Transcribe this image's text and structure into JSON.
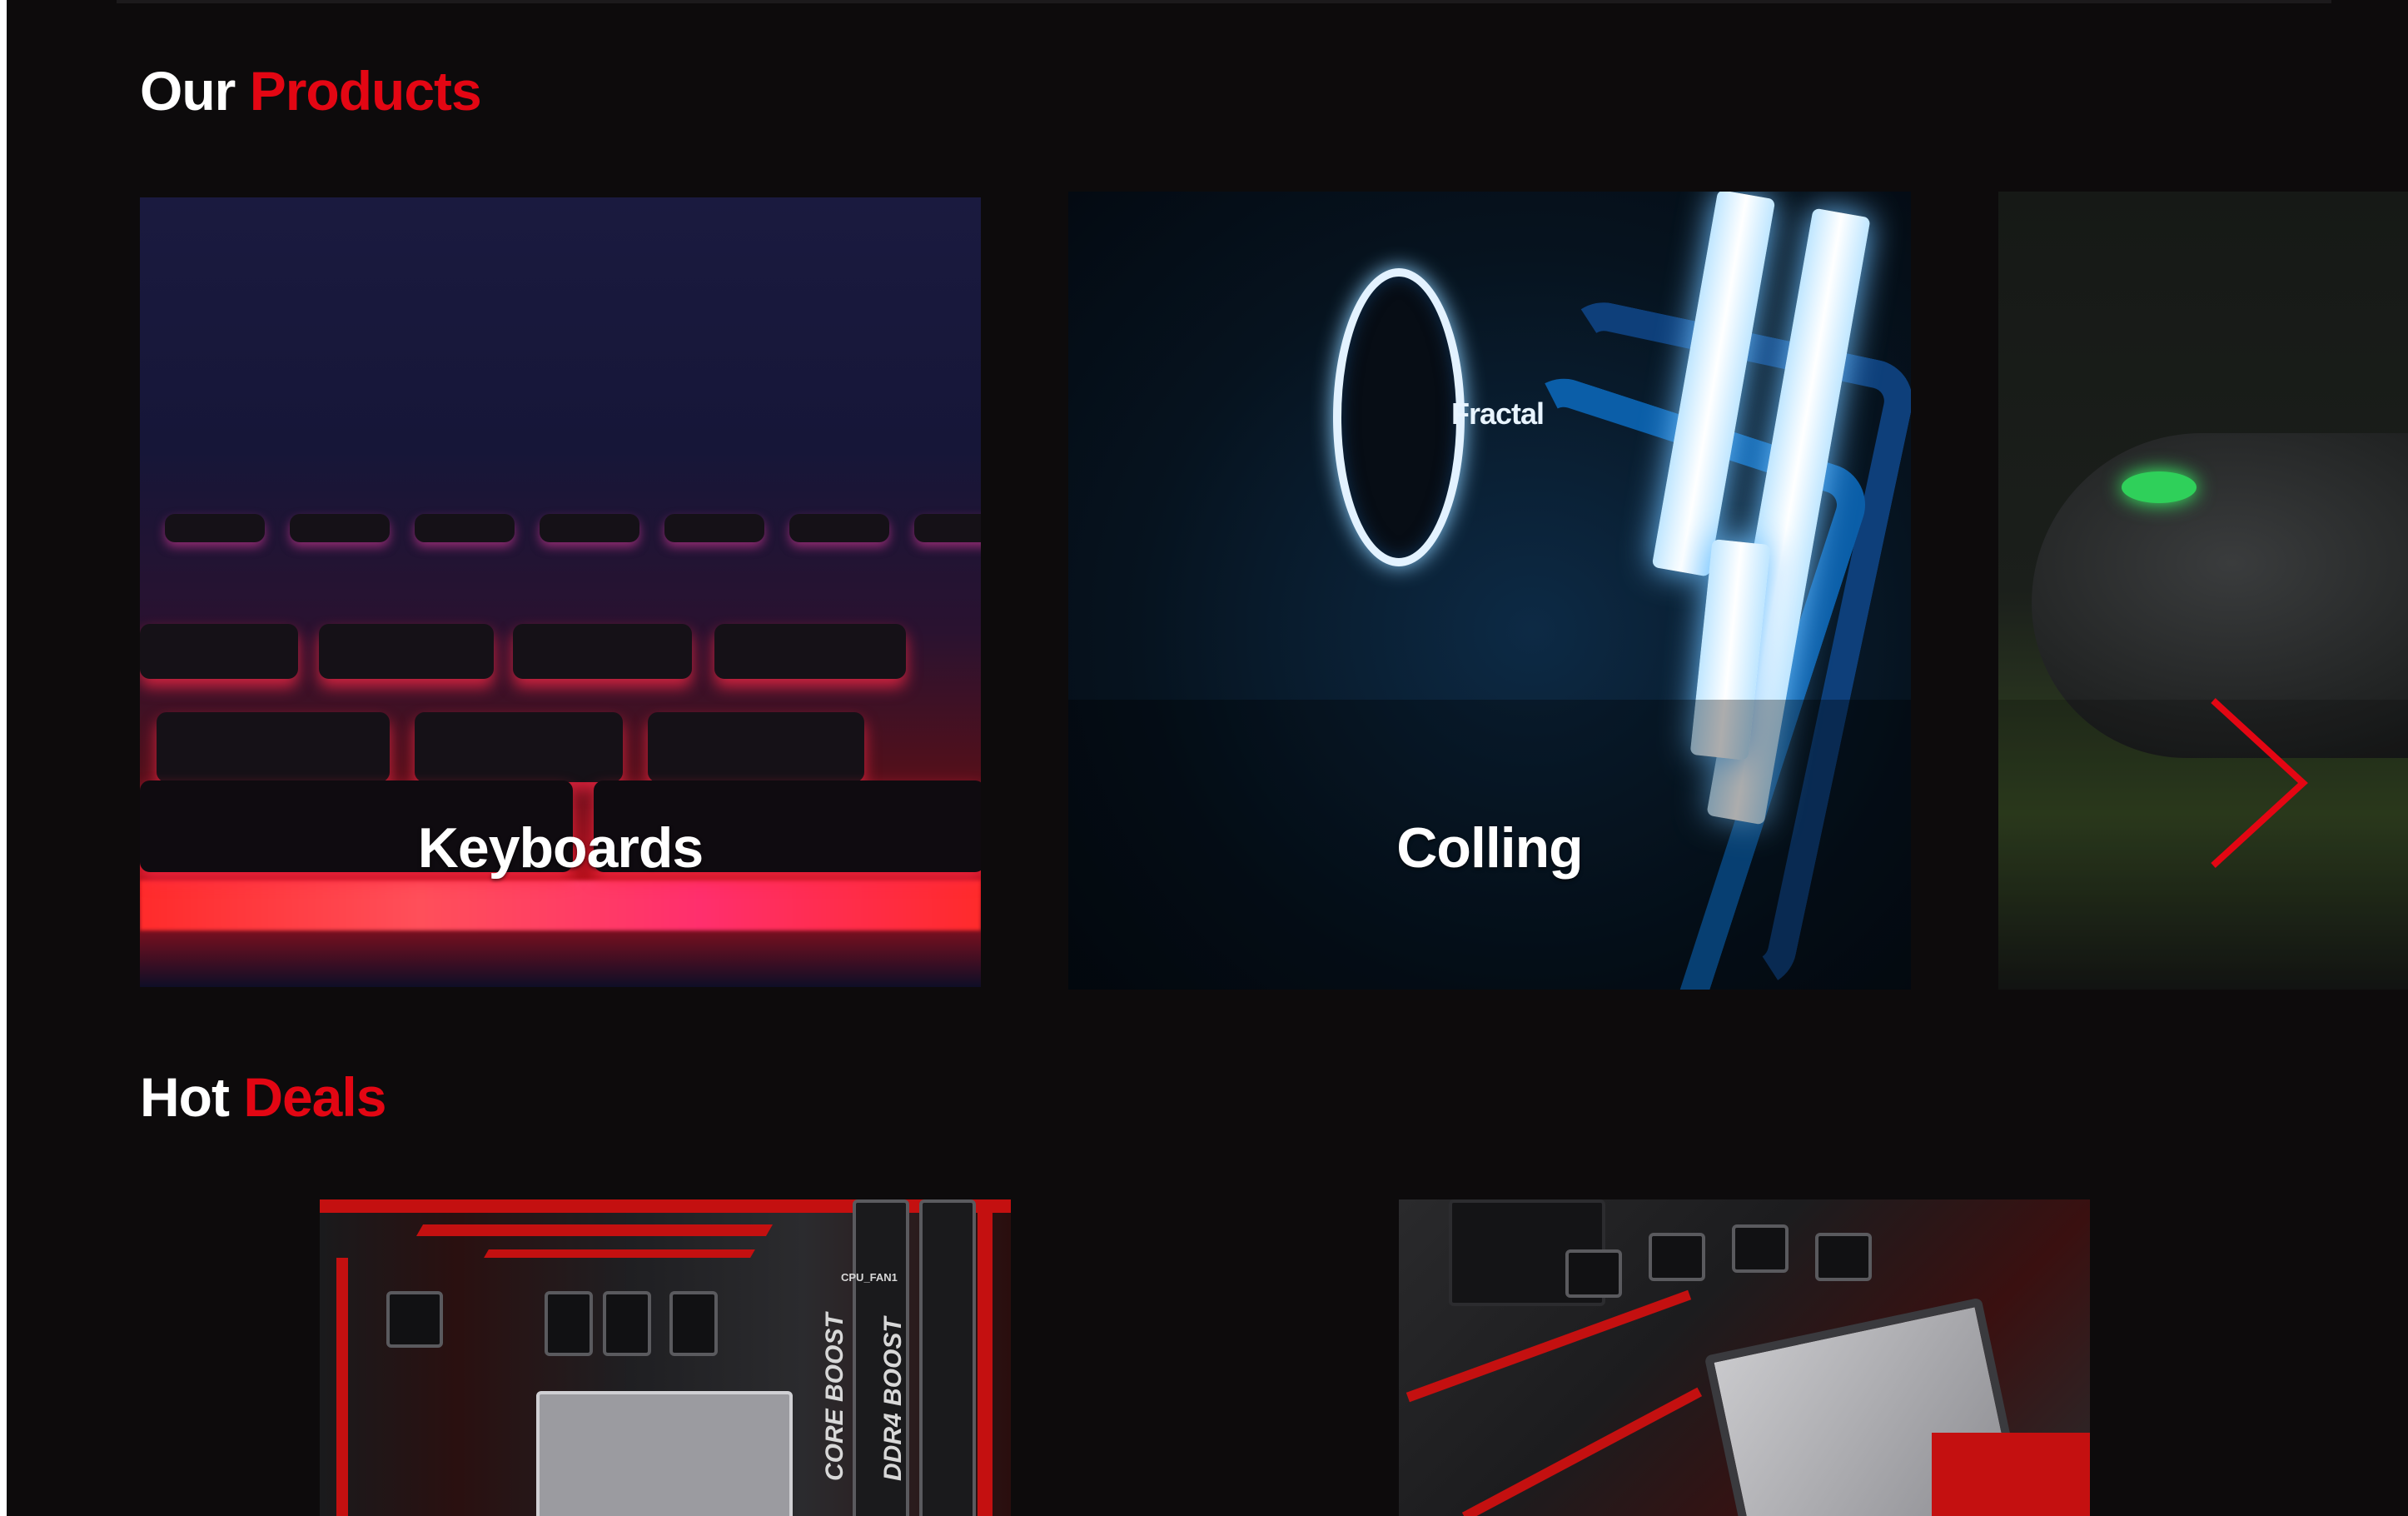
{
  "products": {
    "title_prefix": "Our",
    "title_accent": "Products",
    "items": [
      {
        "label": "Keyboards"
      },
      {
        "label": "Colling"
      },
      {
        "label": ""
      }
    ],
    "next_icon": "chevron-right-icon"
  },
  "deals": {
    "title_prefix": "Hot",
    "title_accent": "Deals",
    "items": [
      {
        "silk_1": "CORE BOOST",
        "silk_2": "DDR4 BOOST",
        "silk_3": "CPU_FAN1"
      },
      {}
    ]
  },
  "product_brand": "Fractal",
  "colors": {
    "accent": "#e30613",
    "background": "#0d0b0c",
    "text": "#ffffff"
  }
}
